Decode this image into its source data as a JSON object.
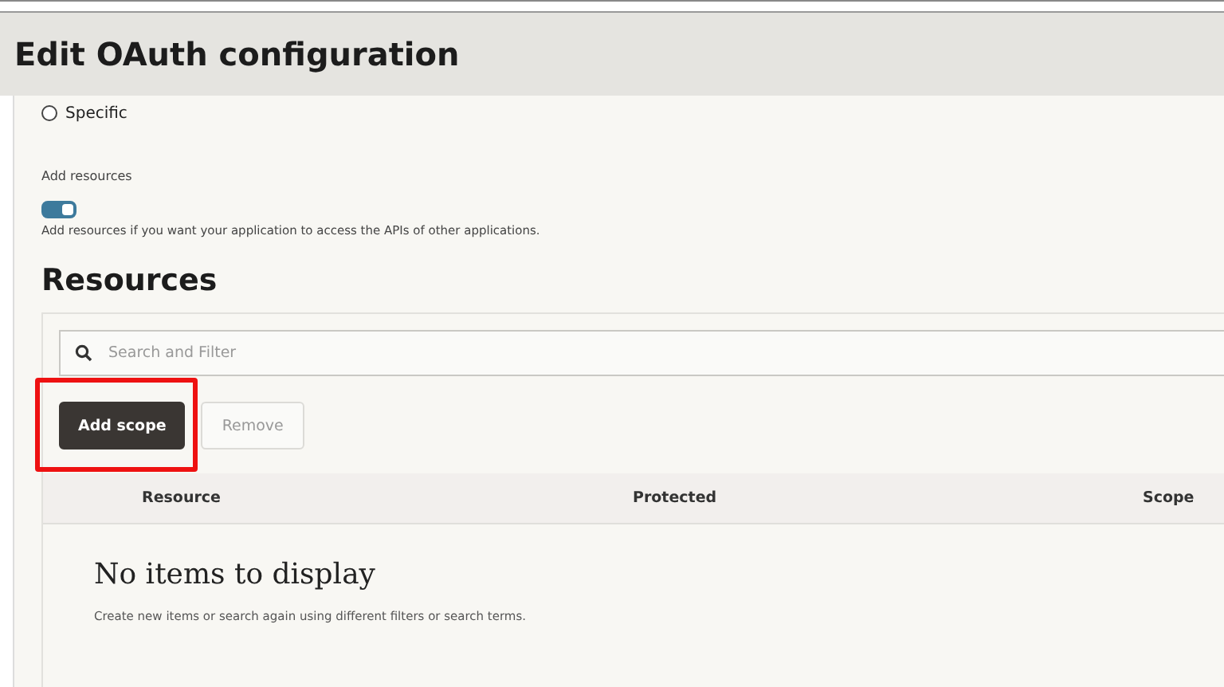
{
  "header": {
    "title": "Edit OAuth configuration"
  },
  "radio": {
    "label": "Specific",
    "selected": false
  },
  "add_resources": {
    "label": "Add resources",
    "on": true,
    "help": "Add resources if you want your application to access the APIs of other applications."
  },
  "section_title": "Resources",
  "search": {
    "placeholder": "Search and Filter"
  },
  "buttons": [
    {
      "label": "Add scope",
      "kind": "primary",
      "highlighted": true
    },
    {
      "label": "Remove",
      "kind": "secondary",
      "highlighted": false
    }
  ],
  "table": {
    "columns": [
      "Resource",
      "Protected",
      "Scope"
    ]
  },
  "empty": {
    "title": "No items to display",
    "help": "Create new items or search again using different filters or search terms."
  }
}
